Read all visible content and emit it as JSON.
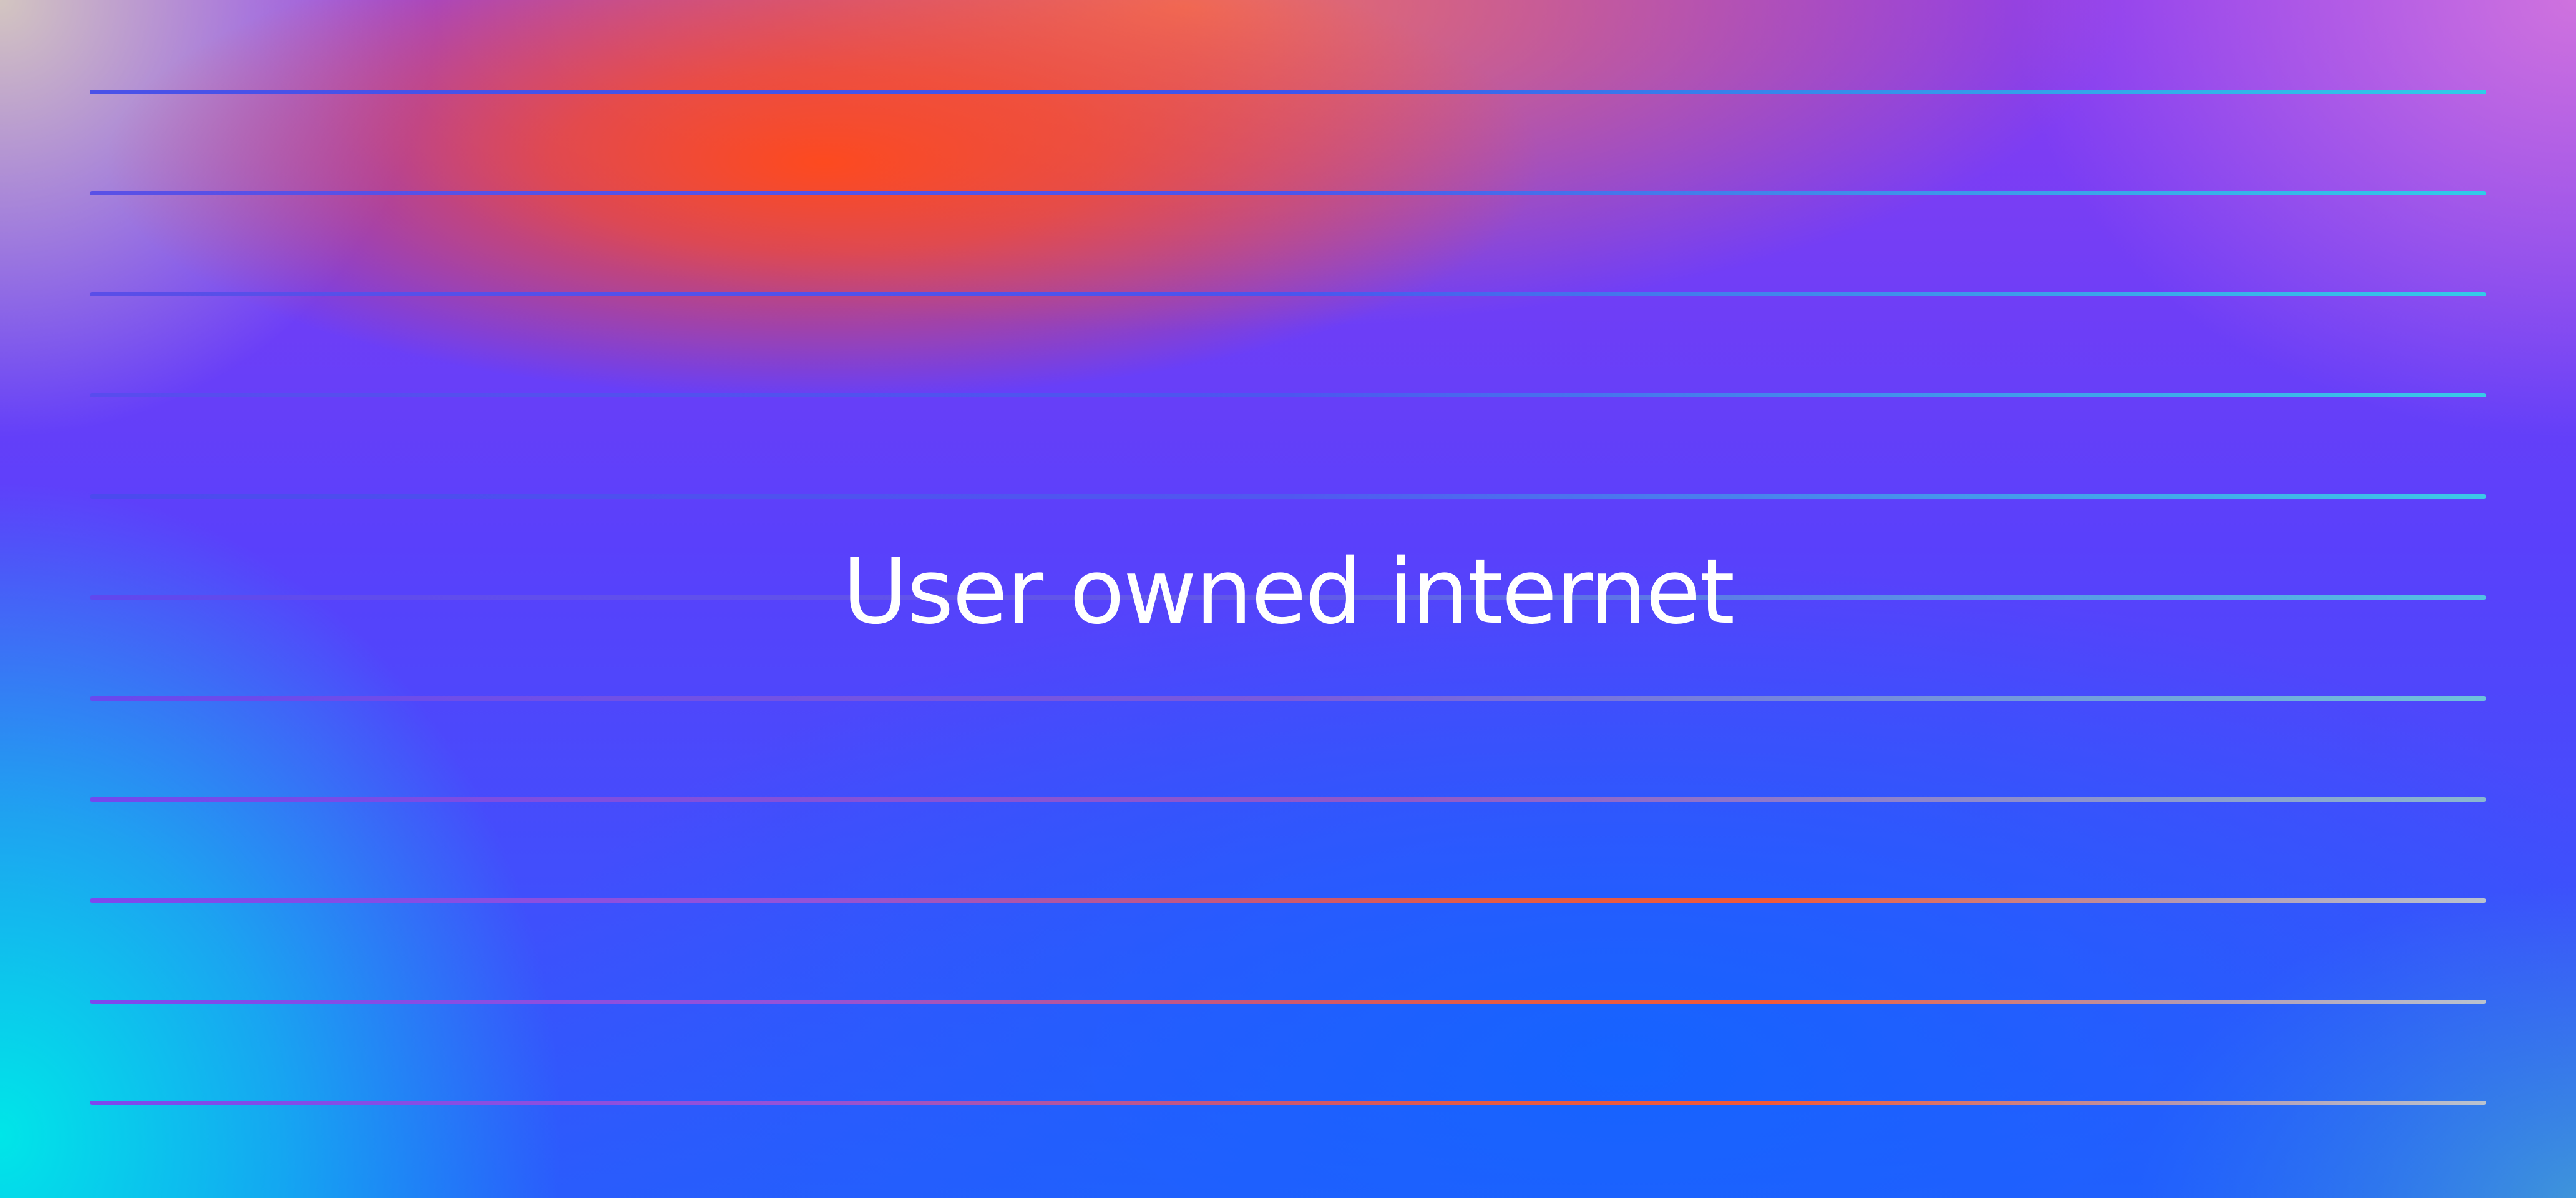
{
  "banner": {
    "title": "User owned internet",
    "colors": {
      "orange": "#ff4a1c",
      "cyan": "#00e6e8",
      "violet": "#6a3cf2",
      "blue": "#1464ff",
      "pink": "#d678dc",
      "line_blue": "#4a4ef0",
      "line_cyan": "#35cbe8"
    },
    "rule_count": 11
  }
}
